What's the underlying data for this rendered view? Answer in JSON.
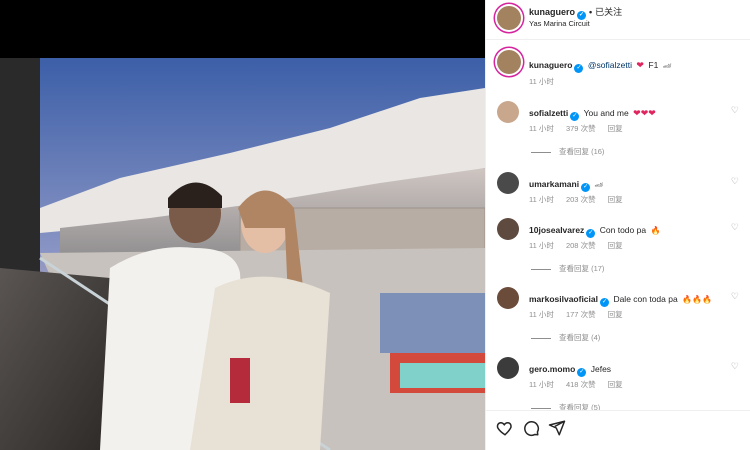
{
  "header": {
    "username": "kunaguero",
    "follow_label": "已关注",
    "location": "Yas Marina Circuit"
  },
  "caption": {
    "username": "kunaguero",
    "mention": "@sofialzetti",
    "text": "F1",
    "time": "11 小时"
  },
  "comments": [
    {
      "username": "sofialzetti",
      "verified": true,
      "text": "You and me",
      "hearts": "❤❤❤",
      "time": "11 小时",
      "likes": "379 次赞",
      "reply": "回复",
      "view_replies": "查看回复 (16)"
    },
    {
      "username": "umarkamani",
      "verified": true,
      "text": "",
      "time": "11 小时",
      "likes": "203 次赞",
      "reply": "回复",
      "view_replies": ""
    },
    {
      "username": "10josealvarez",
      "verified": true,
      "text": "Con todo pa",
      "time": "11 小时",
      "likes": "208 次赞",
      "reply": "回复",
      "view_replies": "查看回复 (17)"
    },
    {
      "username": "markosilvaoficial",
      "verified": true,
      "text": "Dale con toda pa",
      "time": "11 小时",
      "likes": "177 次赞",
      "reply": "回复",
      "view_replies": "查看回复 (4)"
    },
    {
      "username": "gero.momo",
      "verified": true,
      "text": "Jefes",
      "time": "11 小时",
      "likes": "418 次赞",
      "reply": "回复",
      "view_replies": "查看回复 (5)"
    }
  ],
  "icons": [
    "heart-icon",
    "comment-icon",
    "share-icon"
  ]
}
